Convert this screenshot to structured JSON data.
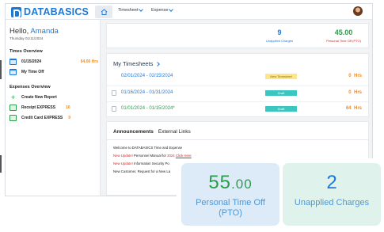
{
  "app": {
    "logo_text": "DATABASICS",
    "nav": [
      {
        "label": "Timesheet"
      },
      {
        "label": "Expense"
      }
    ]
  },
  "sidebar": {
    "greeting": "Hello,",
    "user_name": "Amanda",
    "date": "Thursday 01/11/2024",
    "times_overview": {
      "heading": "Times Overview",
      "items": [
        {
          "label": "01/15/2024",
          "value": "64.00 Hrs",
          "icon": "calendar-icon"
        },
        {
          "label": "My Time Off",
          "value": "",
          "icon": "calendar-icon"
        }
      ]
    },
    "expenses_overview": {
      "heading": "Expenses Overview",
      "items": [
        {
          "label": "Create New Report",
          "value": "",
          "icon": "plus-icon"
        },
        {
          "label": "Receipt EXPRESS",
          "value": "16",
          "icon": "receipt-icon"
        },
        {
          "label": "Credit Card EXPRESS",
          "value": "9",
          "icon": "credit-card-icon"
        }
      ]
    }
  },
  "stats": {
    "unapplied": {
      "value": "9",
      "label": "Unapplied Charges"
    },
    "pto": {
      "value": "45.00",
      "label": "Personal Time Off (PTO)"
    }
  },
  "timesheets": {
    "title": "My Timesheets",
    "rows": [
      {
        "dates": "02/01/2024 - 02/15/2024",
        "status": "New Timesheet",
        "hours": "0",
        "unit": "Hrs"
      },
      {
        "dates": "01/16/2024 - 01/31/2024",
        "status": "Draft",
        "hours": "0",
        "unit": "Hrs"
      },
      {
        "dates": "01/01/2024 - 01/15/2024*",
        "status": "Draft",
        "hours": "64",
        "unit": "Hrs"
      }
    ]
  },
  "announcements": {
    "tabs": [
      "Announcements",
      "External Links"
    ],
    "lines": [
      {
        "parts": [
          {
            "text": "Welcome to DATABASICS Time and Expense"
          }
        ]
      },
      {
        "parts": [
          {
            "text": "New Update! ",
            "style": "red"
          },
          {
            "text": "Personnel Manual for "
          },
          {
            "text": "2024 ",
            "style": "red"
          },
          {
            "text": "Click Here",
            "style": "link"
          }
        ]
      },
      {
        "parts": [
          {
            "text": "New Update! ",
            "style": "red"
          },
          {
            "text": "Information Security Po"
          }
        ]
      },
      {
        "parts": [
          {
            "text": "New Customer, Request for a New La"
          }
        ]
      }
    ]
  },
  "callouts": {
    "pto": {
      "value_whole": "55",
      "value_decimal": ".00",
      "label_line1": "Personal Time Off",
      "label_line2": "(PTO)"
    },
    "unapplied": {
      "value": "2",
      "label": "Unapplied Charges"
    }
  },
  "colors": {
    "brand_blue": "#1e78d6",
    "orange": "#f28c28",
    "green": "#2a9d4a",
    "new_badge": "#fde68a",
    "draft_badge": "#3cc6c0",
    "pto_tile": "#dcebf7",
    "unapplied_tile": "#dff3ec"
  }
}
